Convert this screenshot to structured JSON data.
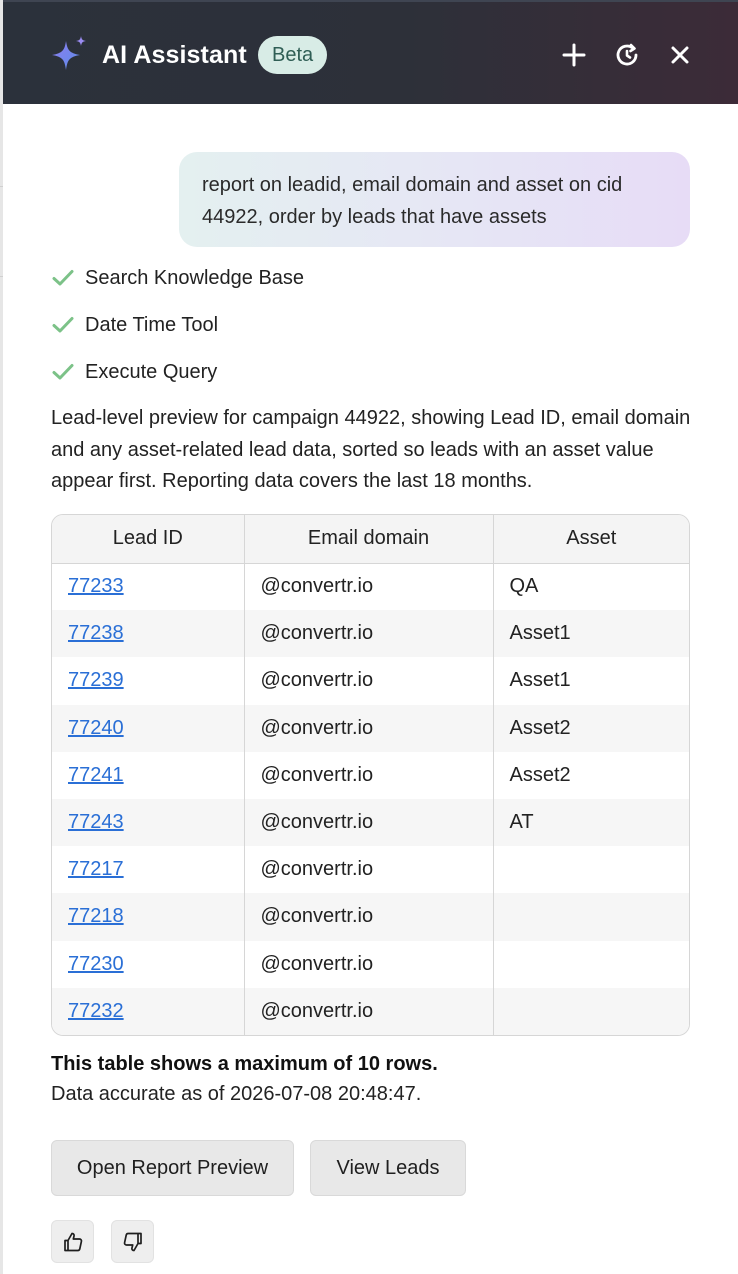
{
  "header": {
    "title": "AI Assistant",
    "badge": "Beta",
    "icons": [
      "sparkle-icon",
      "plus-icon",
      "history-icon",
      "close-icon"
    ]
  },
  "user_message": "report on leadid, email domain and asset on cid 44922, order by leads that have assets",
  "steps": [
    {
      "label": "Search Knowledge Base",
      "status": "done"
    },
    {
      "label": "Date Time Tool",
      "status": "done"
    },
    {
      "label": "Execute Query",
      "status": "done"
    }
  ],
  "answer_text": "Lead-level preview for campaign 44922, showing Lead ID, email domain and any asset-related lead data, sorted so leads with an asset value appear first. Reporting data covers the last 18 months.",
  "table": {
    "headers": {
      "lead_id": "Lead ID",
      "email_domain": "Email domain",
      "asset": "Asset"
    },
    "rows": [
      {
        "lead_id": "77233",
        "email_domain": "@convertr.io",
        "asset": "QA"
      },
      {
        "lead_id": "77238",
        "email_domain": "@convertr.io",
        "asset": "Asset1"
      },
      {
        "lead_id": "77239",
        "email_domain": "@convertr.io",
        "asset": "Asset1"
      },
      {
        "lead_id": "77240",
        "email_domain": "@convertr.io",
        "asset": "Asset2"
      },
      {
        "lead_id": "77241",
        "email_domain": "@convertr.io",
        "asset": "Asset2"
      },
      {
        "lead_id": "77243",
        "email_domain": "@convertr.io",
        "asset": "AT"
      },
      {
        "lead_id": "77217",
        "email_domain": "@convertr.io",
        "asset": ""
      },
      {
        "lead_id": "77218",
        "email_domain": "@convertr.io",
        "asset": ""
      },
      {
        "lead_id": "77230",
        "email_domain": "@convertr.io",
        "asset": ""
      },
      {
        "lead_id": "77232",
        "email_domain": "@convertr.io",
        "asset": ""
      }
    ]
  },
  "notes": {
    "max_rows": "This table shows a maximum of 10 rows.",
    "accuracy": "Data accurate as of 2026-07-08 20:48:47."
  },
  "buttons": {
    "open_report": "Open Report Preview",
    "view_leads": "View Leads"
  },
  "feedback": {
    "icons": [
      "thumbs-up-icon",
      "thumbs-down-icon"
    ]
  },
  "colors": {
    "header_bg": "#2d3039",
    "check": "#7cc288",
    "link": "#2a6fd6",
    "badge_bg": "#d8ece6",
    "user_bubble": "#e6e6f5"
  }
}
